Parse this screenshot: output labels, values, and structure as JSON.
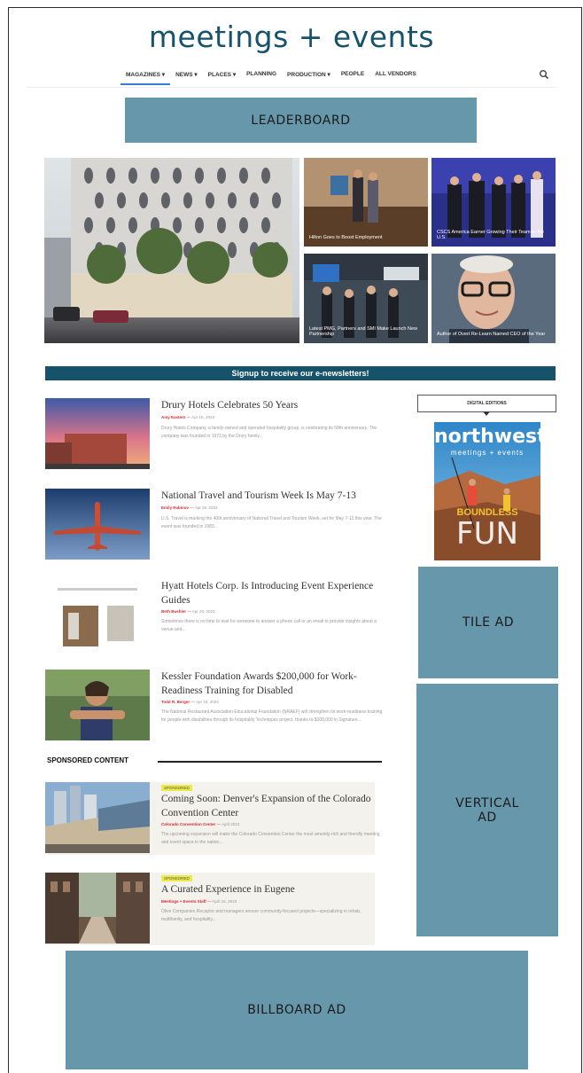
{
  "site": {
    "logo": "meetings + events"
  },
  "nav": {
    "items": [
      {
        "label": "MAGAZINES ▾"
      },
      {
        "label": "NEWS ▾"
      },
      {
        "label": "PLACES ▾"
      },
      {
        "label": "PLANNING"
      },
      {
        "label": "PRODUCTION ▾"
      },
      {
        "label": "PEOPLE"
      },
      {
        "label": "ALL VENDORS"
      }
    ]
  },
  "ads": {
    "leaderboard": "LEADERBOARD",
    "tile": "TILE AD",
    "vertical": "VERTICAL AD",
    "billboard": "BILLBOARD AD"
  },
  "hero": {
    "captions": [
      "Hilton Goes to Boost Employment",
      "CSCS America Earner Growing Their Team to the U.S.",
      "Latest PMG, Partners and SMI Make Launch New Partnership",
      "Author of Overt Re-Learn Named CEO of the Year"
    ]
  },
  "signup": {
    "label": "Signup to receive our e-newsletters!"
  },
  "articles": [
    {
      "title": "Drury Hotels Celebrates 50 Years",
      "author": "Amy Eastern",
      "date": "Apr 15, 2023",
      "excerpt": "Drury Hotels Company, a family-owned and operated hospitality group, is celebrating its 50th anniversary. The company was founded in 1973 by the Drury family..."
    },
    {
      "title": "National Travel and Tourism Week Is May 7-13",
      "author": "Emily Rabinov",
      "date": "Apr 28, 2023",
      "excerpt": "U.S. Travel is marking the 40th anniversary of National Travel and Tourism Week, set for May 7-13 this year. The event was founded in 1983..."
    },
    {
      "title": "Hyatt Hotels Corp. Is Introducing Event Experience Guides",
      "author": "Beth Buehler",
      "date": "Apr 20, 2023",
      "excerpt": "Sometimes there is no time to wait for someone to answer a phone call or an email to provide insights about a venue and..."
    },
    {
      "title": "Kessler Foundation Awards $200,000 for Work-Readiness Training for Disabled",
      "author": "Todd R. Berger",
      "date": "Apr 18, 2023",
      "excerpt": "The National Restaurant Association Educational Foundation (NRAEF) will strengthen its work-readiness training for people with disabilities through its hospitality Techniques project, thanks to $200,000 in Signature..."
    }
  ],
  "sponsored": {
    "heading": "SPONSORED CONTENT",
    "items": [
      {
        "badge": "SPONSORED",
        "title": "Coming Soon: Denver's Expansion of the Colorado Convention Center",
        "author": "Colorado Convention Center",
        "date": "April 2023",
        "excerpt": "The upcoming expansion will make the Colorado Convention Center the most amenity-rich and friendly meeting and event space in the nation..."
      },
      {
        "badge": "SPONSORED",
        "title": "A Curated Experience in Eugene",
        "author": "Meetings + Events Staff",
        "date": "April 15, 2023",
        "excerpt": "Olive Companion Receptor and managers ensure community-focused projects—specializing in rehab, multifamily, and hospitality..."
      }
    ]
  },
  "sidebar": {
    "digital_editions": "DIGITAL EDITIONS",
    "magazine": {
      "title": "northwest",
      "subtitle": "meetings + events",
      "cover_line1": "BOUNDLESS",
      "cover_line2": "FUN"
    }
  },
  "colors": {
    "brand": "#17526b",
    "ad_block": "#6797ab",
    "accent_red": "#d9282f",
    "sponsored_badge": "#ece94a"
  }
}
